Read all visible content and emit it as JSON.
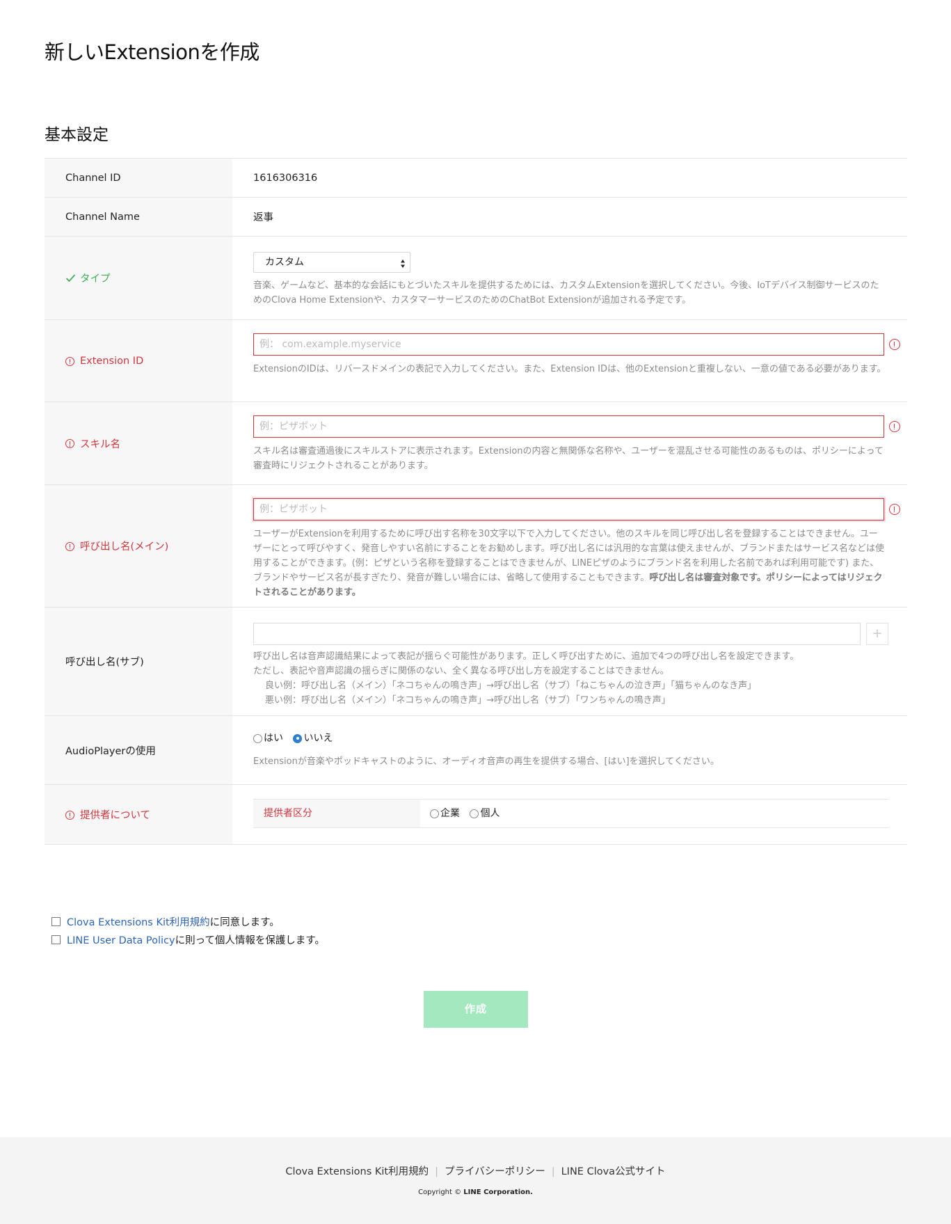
{
  "page": {
    "title": "新しいExtensionを作成",
    "section_title": "基本設定"
  },
  "fields": {
    "channel_id": {
      "label": "Channel ID",
      "value": "1616306316"
    },
    "channel_name": {
      "label": "Channel Name",
      "value": "返事"
    },
    "type": {
      "label": "タイプ",
      "status": "ok",
      "selected": "カスタム",
      "help": "音楽、ゲームなど、基本的な会話にもとづいたスキルを提供するためには、カスタムExtensionを選択してください。今後、IoTデバイス制御サービスのためのClova Home Extensionや、カスタマーサービスのためのChatBot Extensionが追加される予定です。"
    },
    "extension_id": {
      "label": "Extension ID",
      "status": "error",
      "placeholder": "例： com.example.myservice",
      "help": "ExtensionのIDは、リバースドメインの表記で入力してください。また、Extension IDは、他のExtensionと重複しない、一意の値である必要があります。"
    },
    "skill_name": {
      "label": "スキル名",
      "status": "error",
      "placeholder": "例：ピザボット",
      "help": "スキル名は審査通過後にスキルストアに表示されます。Extensionの内容と無関係な名称や、ユーザーを混乱させる可能性のあるものは、ポリシーによって審査時にリジェクトされることがあります。"
    },
    "invocation_main": {
      "label": "呼び出し名(メイン)",
      "status": "error",
      "placeholder": "例：ピザボット",
      "help": "ユーザーがExtensionを利用するために呼び出す名称を30文字以下で入力してください。他のスキルを同じ呼び出し名を登録することはできません。ユーザーにとって呼びやすく、発音しやすい名前にすることをお勧めします。呼び出し名には汎用的な言葉は使えませんが、ブランドまたはサービス名などは使用することができます。(例：ピザという名称を登録することはできませんが、LINEピザのようにブランド名を利用した名前であれば利用可能です) また、ブランドやサービス名が長すぎたり、発音が難しい場合には、省略して使用することもできます。",
      "help_bold": "呼び出し名は審査対象です。ポリシーによってはリジェクトされることがあります。"
    },
    "invocation_sub": {
      "label": "呼び出し名(サブ)",
      "add_symbol": "+",
      "help_lines": [
        "呼び出し名は音声認識結果によって表記が揺らぐ可能性があります。正しく呼び出すために、追加で4つの呼び出し名を設定できます。",
        "ただし、表記や音声認識の揺らぎに関係のない、全く異なる呼び出し方を設定することはできません。",
        "良い例：呼び出し名（メイン）「ネコちゃんの鳴き声」→呼び出し名（サブ）「ねこちゃんの泣き声」「猫ちゃんのなき声」",
        "悪い例：呼び出し名（メイン）「ネコちゃんの鳴き声」→呼び出し名（サブ）「ワンちゃんの鳴き声」"
      ]
    },
    "audio_player": {
      "label": "AudioPlayerの使用",
      "options": [
        "はい",
        "いいえ"
      ],
      "selected": "いいえ",
      "help": "Extensionが音楽やポッドキャストのように、オーディオ音声の再生を提供する場合、[はい]を選択してください。"
    },
    "provider": {
      "label": "提供者について",
      "status": "error",
      "sub_label": "提供者区分",
      "options": [
        "企業",
        "個人"
      ]
    }
  },
  "agreements": [
    {
      "link": "Clova Extensions Kit利用規約",
      "text": "に同意します。"
    },
    {
      "link": "LINE User Data Policy",
      "text": "に則って個人情報を保護します。"
    }
  ],
  "submit": {
    "label": "作成"
  },
  "footer": {
    "links": [
      "Clova Extensions Kit利用規約",
      "プライバシーポリシー",
      "LINE Clova公式サイト"
    ],
    "copyright_prefix": "Copyright ©",
    "copyright_owner": "LINE Corporation."
  },
  "colors": {
    "error": "#d3343c",
    "ok": "#3fae5a",
    "link": "#2c64b5",
    "button": "#a4e8c0",
    "radio_selected": "#2f7fd0"
  }
}
